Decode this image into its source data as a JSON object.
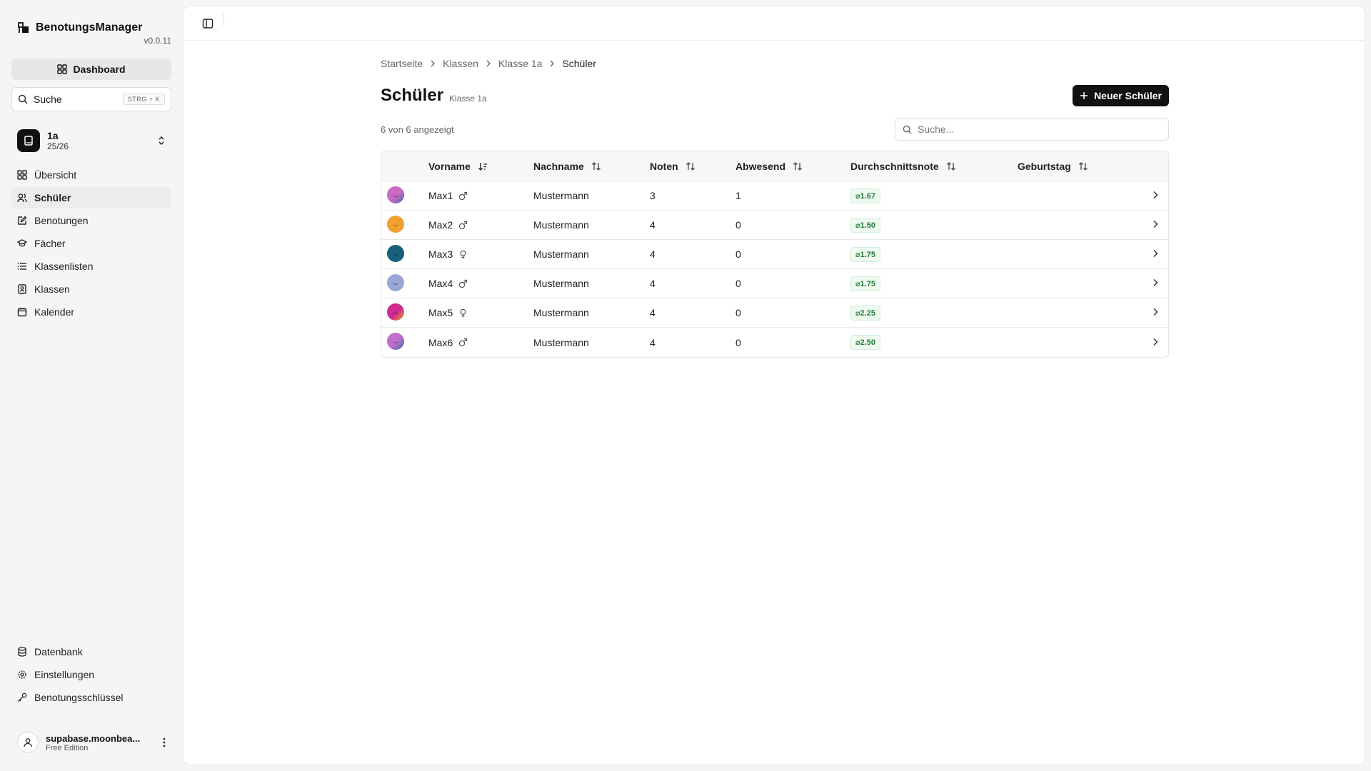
{
  "app": {
    "name": "BenotungsManager",
    "version": "v0.0.11"
  },
  "sidebar": {
    "dashboard_label": "Dashboard",
    "search_label": "Suche",
    "search_shortcut": "STRG + K",
    "class_switcher": {
      "name": "1a",
      "year": "25/26"
    },
    "nav": [
      {
        "label": "Übersicht",
        "icon": "grid-icon"
      },
      {
        "label": "Schüler",
        "icon": "users-icon",
        "active": true
      },
      {
        "label": "Benotungen",
        "icon": "edit-icon"
      },
      {
        "label": "Fächer",
        "icon": "graduation-cap-icon"
      },
      {
        "label": "Klassenlisten",
        "icon": "list-icon"
      },
      {
        "label": "Klassen",
        "icon": "contact-book-icon"
      },
      {
        "label": "Kalender",
        "icon": "calendar-icon"
      }
    ],
    "bottom_nav": [
      {
        "label": "Datenbank",
        "icon": "database-icon"
      },
      {
        "label": "Einstellungen",
        "icon": "gear-icon"
      },
      {
        "label": "Benotungsschlüssel",
        "icon": "key-icon"
      }
    ],
    "user": {
      "name": "supabase.moonbea...",
      "edition": "Free Edition"
    }
  },
  "breadcrumb": [
    "Startseite",
    "Klassen",
    "Klasse 1a",
    "Schüler"
  ],
  "page": {
    "title": "Schüler",
    "subtitle": "Klasse 1a",
    "new_button": "Neuer Schüler",
    "count_text": "6 von 6 angezeigt",
    "search_placeholder": "Suche..."
  },
  "table": {
    "columns": [
      "Vorname",
      "Nachname",
      "Noten",
      "Abwesend",
      "Durchschnittsnote",
      "Geburtstag"
    ],
    "rows": [
      {
        "first": "Max1",
        "gender": "male",
        "last": "Mustermann",
        "grades": "3",
        "absent": "1",
        "average": "⌀1.67",
        "birthday": "",
        "avatar_color": "#c86ac0",
        "avatar_color2": "#3a6db0"
      },
      {
        "first": "Max2",
        "gender": "male",
        "last": "Mustermann",
        "grades": "4",
        "absent": "0",
        "average": "⌀1.50",
        "birthday": "",
        "avatar_color": "#f0a030",
        "avatar_color2": "#f0a030"
      },
      {
        "first": "Max3",
        "gender": "female",
        "last": "Mustermann",
        "grades": "4",
        "absent": "0",
        "average": "⌀1.75",
        "birthday": "",
        "avatar_color": "#16607a",
        "avatar_color2": "#16607a"
      },
      {
        "first": "Max4",
        "gender": "male",
        "last": "Mustermann",
        "grades": "4",
        "absent": "0",
        "average": "⌀1.75",
        "birthday": "",
        "avatar_color": "#9aa6d6",
        "avatar_color2": "#9aa6d6"
      },
      {
        "first": "Max5",
        "gender": "female",
        "last": "Mustermann",
        "grades": "4",
        "absent": "0",
        "average": "⌀2.25",
        "birthday": "",
        "avatar_color": "#d02a90",
        "avatar_color2": "#e8a020"
      },
      {
        "first": "Max6",
        "gender": "male",
        "last": "Mustermann",
        "grades": "4",
        "absent": "0",
        "average": "⌀2.50",
        "birthday": "",
        "avatar_color": "#c070c8",
        "avatar_color2": "#2a70b0"
      }
    ]
  },
  "colors": {
    "primary": "#111111",
    "badge_green": "#1e7a3a",
    "active_nav": "#ececec"
  }
}
